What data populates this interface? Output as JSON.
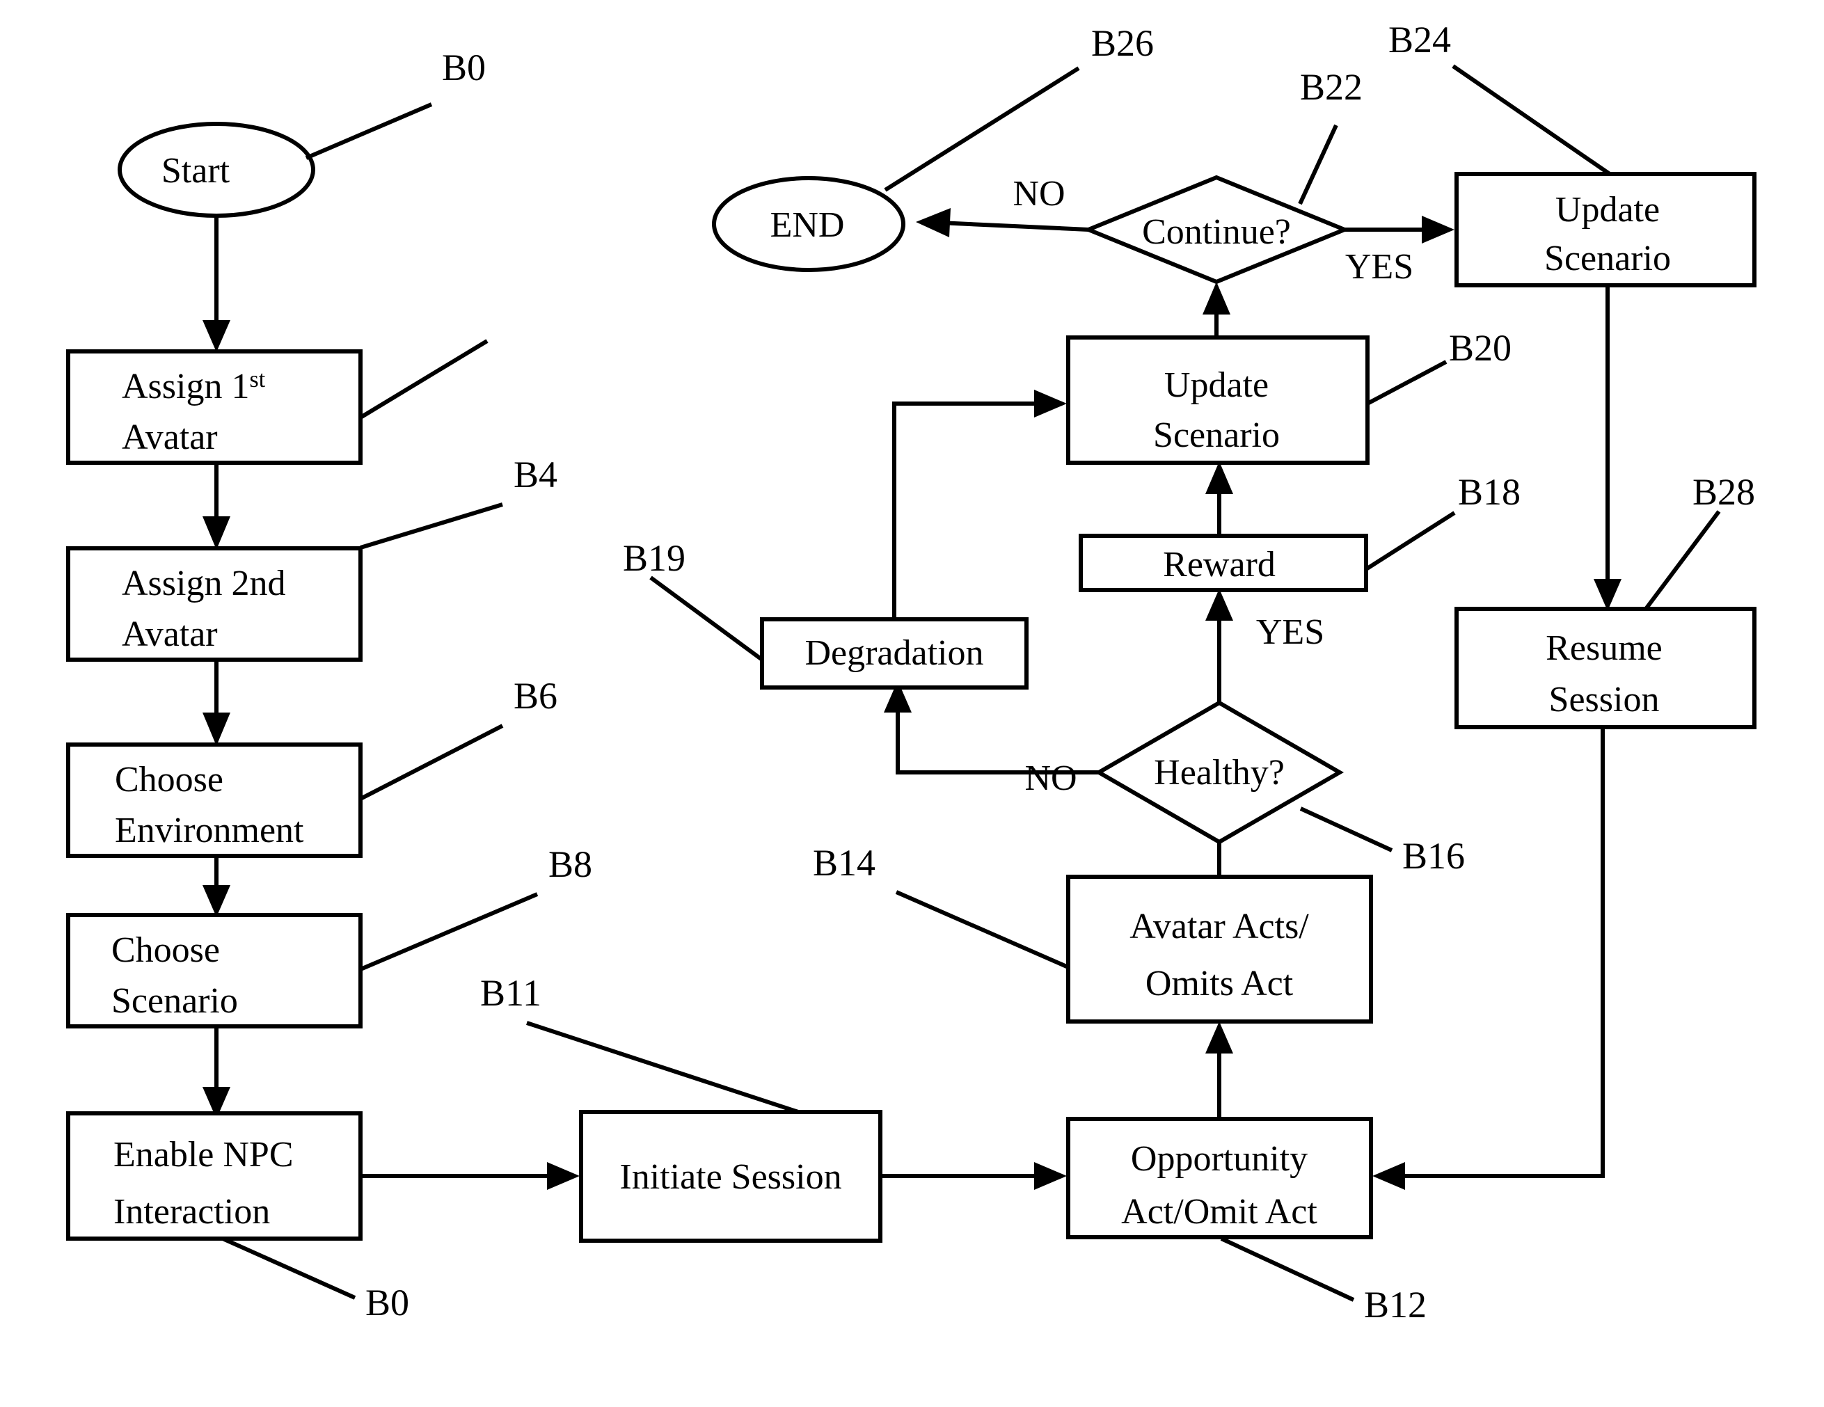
{
  "diagram": {
    "type": "flowchart",
    "title": "",
    "background_color": "#ffffff",
    "line_color": "#000000",
    "nodes": {
      "start": {
        "label": "Start",
        "shape": "ellipse",
        "ref": "B0"
      },
      "assign_first_avatar": {
        "label_line1": "Assign 1",
        "label_sup": "st",
        "label_line2": "Avatar",
        "shape": "rect",
        "ref": "B0"
      },
      "assign_second_avatar": {
        "label_line1": "Assign 2nd",
        "label_line2": "Avatar",
        "shape": "rect",
        "ref": "B4"
      },
      "choose_environment": {
        "label_line1": "Choose",
        "label_line2": "Environment",
        "shape": "rect",
        "ref": "B6"
      },
      "choose_scenario": {
        "label_line1": "Choose",
        "label_line2": "Scenario",
        "shape": "rect",
        "ref": "B8"
      },
      "enable_npc_interaction": {
        "label_line1": "Enable NPC",
        "label_line2": "Interaction",
        "shape": "rect",
        "ref": "B0"
      },
      "initiate_session": {
        "label": "Initiate Session",
        "shape": "rect",
        "ref": "B11"
      },
      "opportunity_act": {
        "label_line1": "Opportunity",
        "label_line2": "Act/Omit Act",
        "shape": "rect",
        "ref": "B12"
      },
      "avatar_acts": {
        "label_line1": "Avatar Acts/",
        "label_line2": "Omits Act",
        "shape": "rect",
        "ref": "B14"
      },
      "healthy_decision": {
        "label": "Healthy?",
        "shape": "diamond",
        "ref": "B16"
      },
      "reward": {
        "label": "Reward",
        "shape": "rect",
        "ref": "B18"
      },
      "degradation": {
        "label": "Degradation",
        "shape": "rect",
        "ref": "B20"
      },
      "update_scenario_mid": {
        "label_line1": "Update",
        "label_line2": "Scenario",
        "shape": "rect",
        "ref": "B19"
      },
      "continue_decision": {
        "label": "Continue?",
        "shape": "diamond",
        "ref": "B22"
      },
      "update_scenario_top": {
        "label_line1": "Update",
        "label_line2": "Scenario",
        "shape": "rect",
        "ref": "B24"
      },
      "end": {
        "label": "END",
        "shape": "ellipse",
        "ref": "B26"
      },
      "resume_session": {
        "label_line1": "Resume",
        "label_line2": "Session",
        "shape": "rect",
        "ref": "B28"
      }
    },
    "reference_labels": [
      {
        "id": "ref-b0-start",
        "text": "B0"
      },
      {
        "id": "ref-b4",
        "text": "B4"
      },
      {
        "id": "ref-b6",
        "text": "B6"
      },
      {
        "id": "ref-b8",
        "text": "B8"
      },
      {
        "id": "ref-b0-npc",
        "text": "B0"
      },
      {
        "id": "ref-b11",
        "text": "B11"
      },
      {
        "id": "ref-b12",
        "text": "B12"
      },
      {
        "id": "ref-b14",
        "text": "B14"
      },
      {
        "id": "ref-b16",
        "text": "B16"
      },
      {
        "id": "ref-b18",
        "text": "B18"
      },
      {
        "id": "ref-b19",
        "text": "B19"
      },
      {
        "id": "ref-b20",
        "text": "B20"
      },
      {
        "id": "ref-b22",
        "text": "B22"
      },
      {
        "id": "ref-b24",
        "text": "B24"
      },
      {
        "id": "ref-b26",
        "text": "B26"
      },
      {
        "id": "ref-b28",
        "text": "B28"
      }
    ],
    "edge_labels": {
      "healthy_yes": "YES",
      "healthy_no": "NO",
      "continue_yes": "YES",
      "continue_no": "NO"
    },
    "edges": [
      {
        "from": "start",
        "to": "assign_first_avatar",
        "label": ""
      },
      {
        "from": "assign_first_avatar",
        "to": "assign_second_avatar",
        "label": ""
      },
      {
        "from": "assign_second_avatar",
        "to": "choose_environment",
        "label": ""
      },
      {
        "from": "choose_environment",
        "to": "choose_scenario",
        "label": ""
      },
      {
        "from": "choose_scenario",
        "to": "enable_npc_interaction",
        "label": ""
      },
      {
        "from": "enable_npc_interaction",
        "to": "initiate_session",
        "label": ""
      },
      {
        "from": "initiate_session",
        "to": "opportunity_act",
        "label": ""
      },
      {
        "from": "opportunity_act",
        "to": "avatar_acts",
        "label": ""
      },
      {
        "from": "avatar_acts",
        "to": "healthy_decision",
        "label": ""
      },
      {
        "from": "healthy_decision",
        "to": "reward",
        "label": "YES"
      },
      {
        "from": "healthy_decision",
        "to": "degradation",
        "label": "NO"
      },
      {
        "from": "reward",
        "to": "update_scenario_mid",
        "label": ""
      },
      {
        "from": "degradation",
        "to": "update_scenario_mid",
        "label": ""
      },
      {
        "from": "update_scenario_mid",
        "to": "continue_decision",
        "label": ""
      },
      {
        "from": "continue_decision",
        "to": "end",
        "label": "NO"
      },
      {
        "from": "continue_decision",
        "to": "update_scenario_top",
        "label": "YES"
      },
      {
        "from": "update_scenario_top",
        "to": "resume_session",
        "label": ""
      },
      {
        "from": "resume_session",
        "to": "opportunity_act",
        "label": ""
      }
    ]
  }
}
